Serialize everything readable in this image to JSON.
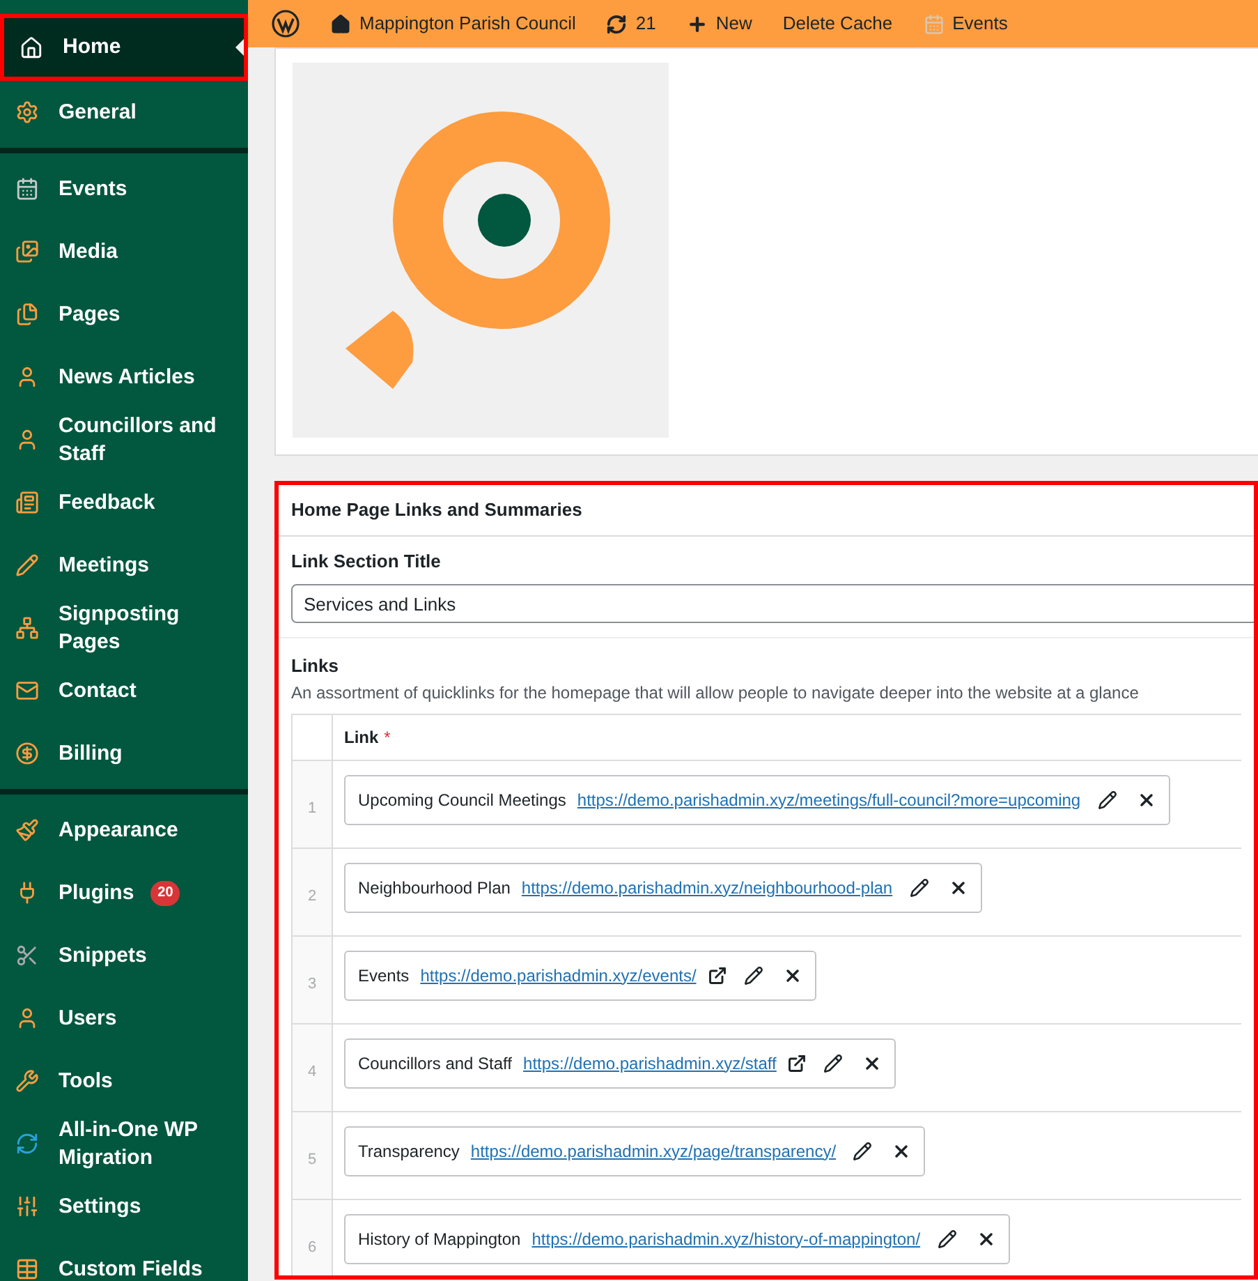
{
  "sidebar": {
    "groups": [
      {
        "items": [
          {
            "label": "Home",
            "selected": true
          },
          {
            "label": "General",
            "selected": false
          }
        ]
      },
      {
        "items": [
          {
            "label": "Events",
            "selected": false
          },
          {
            "label": "Media",
            "selected": false
          },
          {
            "label": "Pages",
            "selected": false
          },
          {
            "label": "News Articles",
            "selected": false
          },
          {
            "label": "Councillors and Staff",
            "selected": false
          },
          {
            "label": "Feedback",
            "selected": false
          },
          {
            "label": "Meetings",
            "selected": false
          },
          {
            "label": "Signposting Pages",
            "selected": false
          },
          {
            "label": "Contact",
            "selected": false
          },
          {
            "label": "Billing",
            "selected": false
          }
        ]
      },
      {
        "items": [
          {
            "label": "Appearance",
            "selected": false
          },
          {
            "label": "Plugins",
            "selected": false,
            "badge": "20"
          },
          {
            "label": "Snippets",
            "selected": false
          },
          {
            "label": "Users",
            "selected": false
          },
          {
            "label": "Tools",
            "selected": false
          },
          {
            "label": "All-in-One WP Migration",
            "selected": false
          },
          {
            "label": "Settings",
            "selected": false
          },
          {
            "label": "Custom Fields",
            "selected": false
          }
        ]
      }
    ]
  },
  "admin_bar": {
    "site": "Mappington Parish Council",
    "updates": "21",
    "new": "New",
    "delete_cache": "Delete Cache",
    "events": "Events"
  },
  "section": {
    "title": "Home Page Links and Summaries",
    "title_field": {
      "label": "Link Section Title",
      "value": "Services and Links"
    },
    "links": {
      "label": "Links",
      "description": "An assortment of quicklinks for the homepage that will allow people to navigate deeper into the website at a glance",
      "column": "Link",
      "required_mark": "*",
      "rows": [
        {
          "number": "1",
          "title": "Upcoming Council Meetings",
          "url": "https://demo.parishadmin.xyz/meetings/full-council?more=upcoming",
          "external": false
        },
        {
          "number": "2",
          "title": "Neighbourhood Plan",
          "url": "https://demo.parishadmin.xyz/neighbourhood-plan",
          "external": false
        },
        {
          "number": "3",
          "title": "Events",
          "url": "https://demo.parishadmin.xyz/events/",
          "external": true
        },
        {
          "number": "4",
          "title": "Councillors and Staff",
          "url": "https://demo.parishadmin.xyz/staff",
          "external": true
        },
        {
          "number": "5",
          "title": "Transparency",
          "url": "https://demo.parishadmin.xyz/page/transparency/",
          "external": false
        },
        {
          "number": "6",
          "title": "History of Mappington",
          "url": "https://demo.parishadmin.xyz/history-of-mappington/",
          "external": false
        }
      ]
    }
  }
}
